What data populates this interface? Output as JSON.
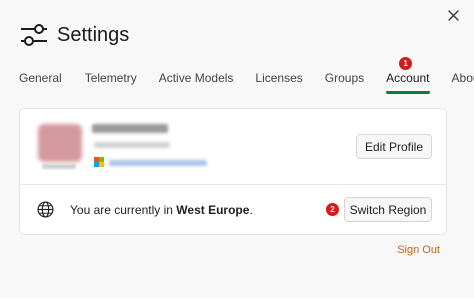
{
  "window": {
    "close_icon": "close-icon"
  },
  "header": {
    "title": "Settings",
    "icon": "sliders-icon"
  },
  "tabs": [
    {
      "label": "General"
    },
    {
      "label": "Telemetry"
    },
    {
      "label": "Active Models"
    },
    {
      "label": "Licenses"
    },
    {
      "label": "Groups"
    },
    {
      "label": "Account",
      "active": true,
      "badge": "1"
    },
    {
      "label": "About"
    }
  ],
  "profile": {
    "edit_button": "Edit Profile",
    "avatar_color": "#d59a9e"
  },
  "region": {
    "prefix": "You are currently in ",
    "name": "West Europe",
    "suffix": ".",
    "icon": "globe-icon",
    "switch_button": "Switch Region",
    "badge": "2"
  },
  "footer": {
    "sign_out": "Sign Out"
  },
  "colors": {
    "accent": "#0f7b44",
    "badge": "#d21c1c",
    "link": "#c4621a"
  }
}
